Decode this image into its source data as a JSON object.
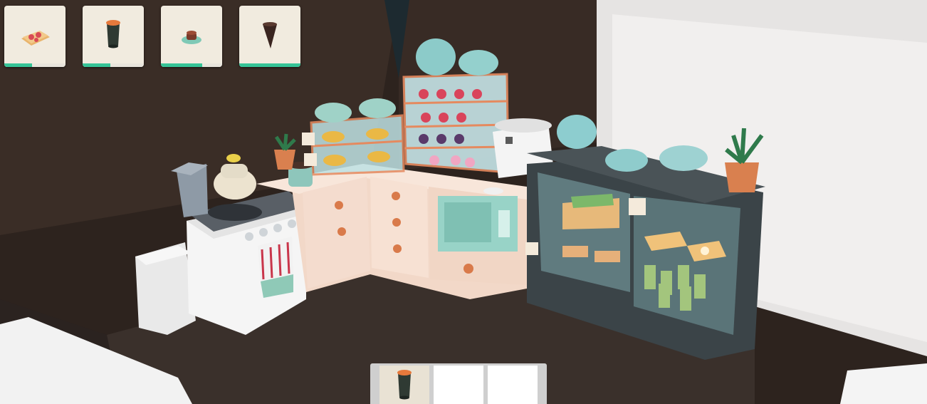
{
  "orders": [
    {
      "item_icon": "toast-icon",
      "progress": 0.45
    },
    {
      "item_icon": "iced-drink-icon",
      "progress": 0.45
    },
    {
      "item_icon": "coffee-cup-icon",
      "progress": 0.68
    },
    {
      "item_icon": "chocolate-cake-slice-icon",
      "progress": 1.0
    }
  ],
  "inventory": {
    "slots": [
      {
        "item_icon": "iced-drink-icon",
        "selected": true
      },
      {
        "item_icon": "",
        "selected": false
      },
      {
        "item_icon": "",
        "selected": false
      }
    ]
  },
  "colors": {
    "progress_fill": "#35c497",
    "wall": "#3a2d26",
    "counter": "#f4dccd",
    "display_case": "#3b4448"
  }
}
